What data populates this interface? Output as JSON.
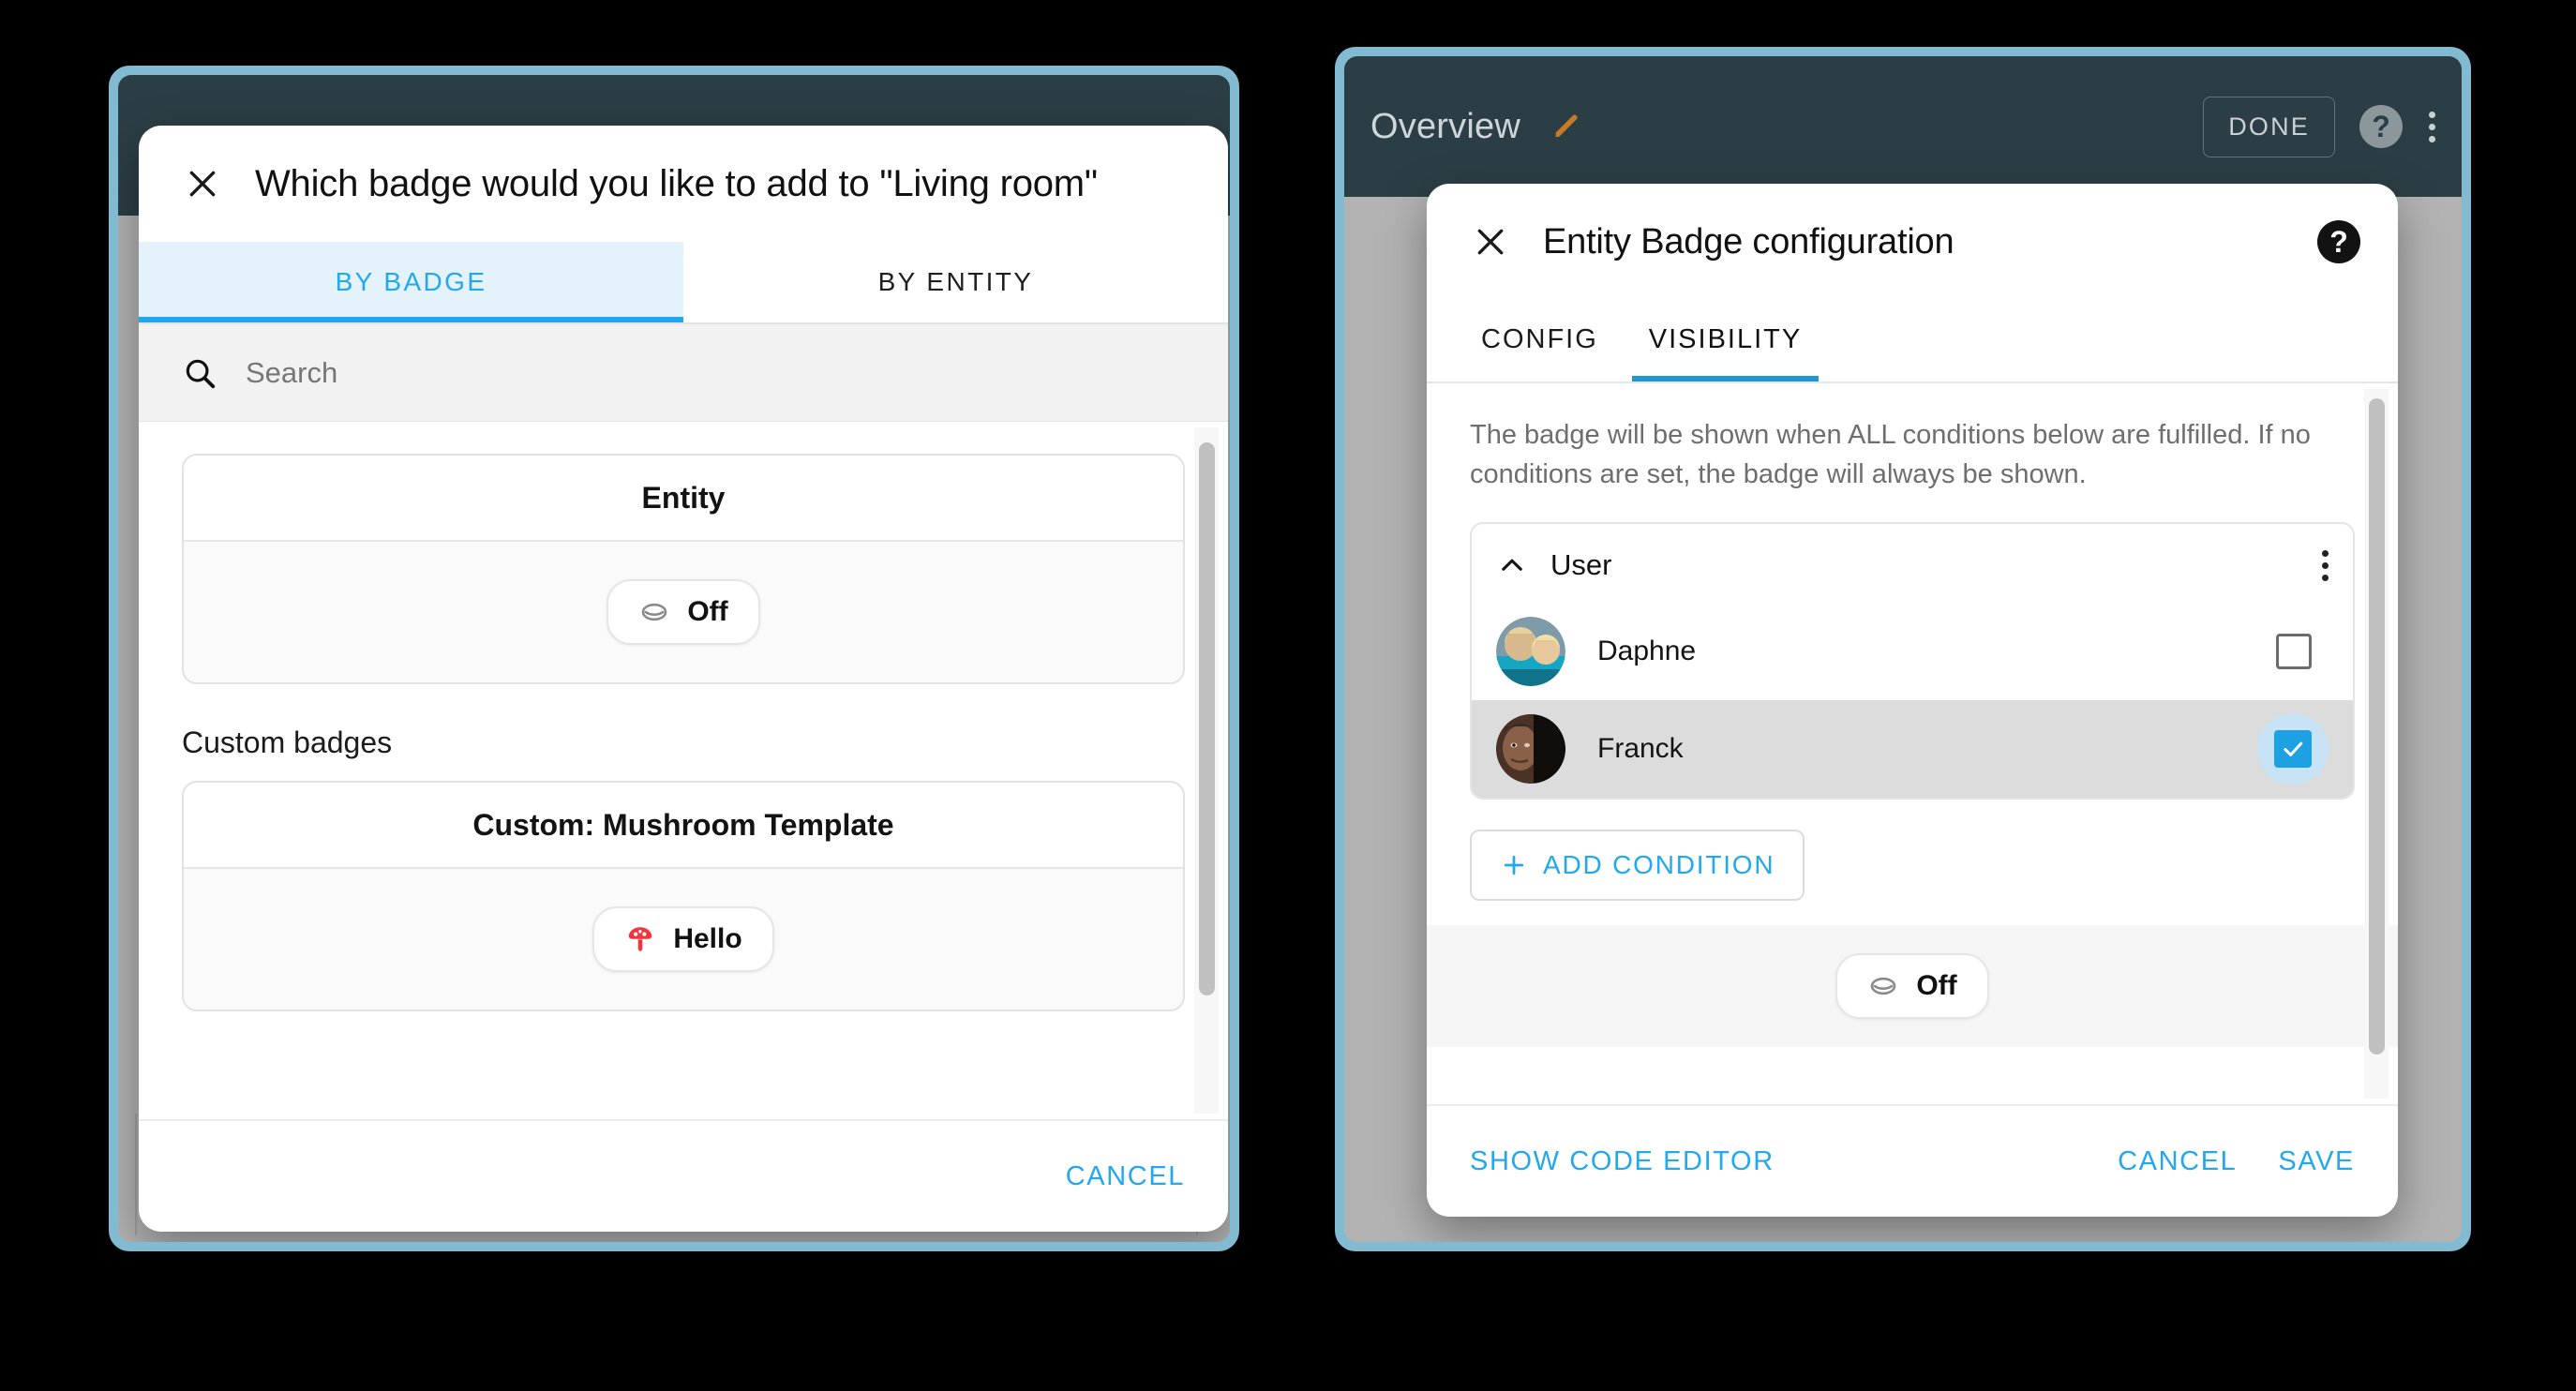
{
  "left_panel": {
    "appbar": {
      "title": "",
      "done_label": "",
      "help_label": "?"
    },
    "background": {
      "chip_label": ""
    },
    "dialog": {
      "title": "Which badge would you like to add to \"Living room\"",
      "close_icon": "close-icon",
      "tabs": [
        {
          "label": "BY BADGE",
          "active": true
        },
        {
          "label": "BY ENTITY",
          "active": false
        }
      ],
      "search": {
        "placeholder": "Search",
        "value": "",
        "icon": "search-icon"
      },
      "badges": [
        {
          "name": "Entity",
          "chip": {
            "label": "Off",
            "icon": "eye-outline-icon",
            "icon_color": "#8a8a8a"
          }
        }
      ],
      "custom_section_title": "Custom badges",
      "custom_badges": [
        {
          "name": "Custom: Mushroom Template",
          "chip": {
            "label": "Hello",
            "icon": "mushroom-icon",
            "icon_color": "#f4333d"
          }
        }
      ],
      "footer": {
        "cancel_label": "CANCEL"
      }
    }
  },
  "right_panel": {
    "appbar": {
      "title": "Overview",
      "edit_icon": "pencil-icon",
      "edit_icon_color": "#c97b23",
      "done_label": "DONE",
      "help_label": "?",
      "menu_icon": "overflow-menu-icon"
    },
    "dialog": {
      "title": "Entity Badge configuration",
      "close_icon": "close-icon",
      "help_label": "?",
      "tabs": [
        {
          "label": "CONFIG",
          "active": false
        },
        {
          "label": "VISIBILITY",
          "active": true
        }
      ],
      "description": "The badge will be shown when ALL conditions below are fulfilled. If no conditions are set, the badge will always be shown.",
      "condition": {
        "title": "User",
        "collapse_icon": "chevron-up-icon",
        "menu_icon": "overflow-menu-icon",
        "users": [
          {
            "name": "Daphne",
            "checked": false
          },
          {
            "name": "Franck",
            "checked": true
          }
        ]
      },
      "add_condition_label": "ADD CONDITION",
      "add_condition_icon": "plus-icon",
      "preview_chip": {
        "label": "Off",
        "icon": "eye-outline-icon"
      },
      "footer": {
        "code_editor_label": "SHOW CODE EDITOR",
        "cancel_label": "CANCEL",
        "save_label": "SAVE"
      }
    }
  },
  "colors": {
    "accent": "#22a8ef",
    "frame": "#82bad1",
    "appbar": "#2c3e45",
    "tab_active_bg": "#e3f2fb",
    "checkbox_checked": "#1ea1e2"
  }
}
